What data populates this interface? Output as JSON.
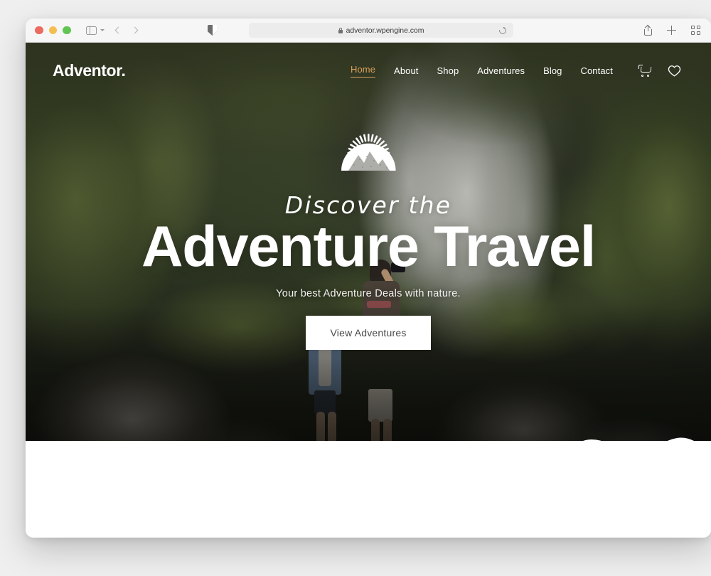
{
  "browser": {
    "traffic_lights": [
      "close",
      "minimize",
      "zoom"
    ],
    "sidebar_label": "sidebar-toggle",
    "back_label": "back",
    "forward_label": "forward",
    "privacy_label": "privacy-report",
    "url": "adventor.wpengine.com",
    "url_secure": true,
    "reload_label": "reload",
    "share_label": "share",
    "new_tab_label": "new-tab",
    "tab_overview_label": "tab-overview"
  },
  "site": {
    "logo": "Adventor.",
    "nav": [
      {
        "label": "Home",
        "active": true
      },
      {
        "label": "About",
        "active": false
      },
      {
        "label": "Shop",
        "active": false
      },
      {
        "label": "Adventures",
        "active": false
      },
      {
        "label": "Blog",
        "active": false
      },
      {
        "label": "Contact",
        "active": false
      }
    ],
    "nav_icons": [
      {
        "name": "cart-icon"
      },
      {
        "name": "heart-icon"
      }
    ],
    "hero": {
      "emblem": "mountain-sunburst-badge",
      "script_line": "Discover the",
      "headline": "Adventure Travel",
      "subline": "Your best Adventure Deals with nature.",
      "cta_label": "View Adventures"
    }
  },
  "colors": {
    "accent": "#d9a05b",
    "hero_text": "#ffffff",
    "cta_bg": "#ffffff",
    "cta_text": "#4a4a4a",
    "page_bg": "#efefef",
    "toolbar_bg": "#f6f6f6"
  }
}
